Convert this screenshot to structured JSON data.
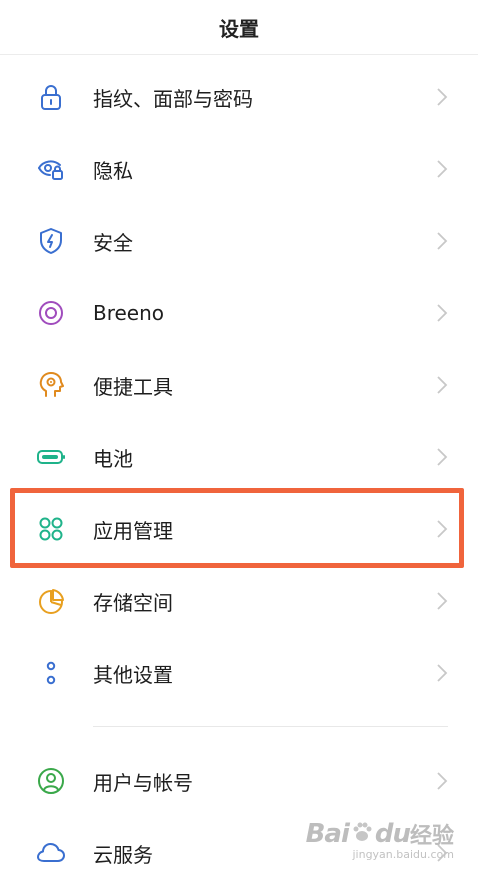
{
  "header": {
    "title": "设置"
  },
  "items": [
    {
      "label": "指纹、面部与密码",
      "icon": "lock-icon",
      "color": "#3a6fd0"
    },
    {
      "label": "隐私",
      "icon": "privacy-eye-icon",
      "color": "#3a6fd0"
    },
    {
      "label": "安全",
      "icon": "shield-icon",
      "color": "#3a6fd0"
    },
    {
      "label": "Breeno",
      "icon": "breeno-ring-icon",
      "color": "#a04cbd"
    },
    {
      "label": "便捷工具",
      "icon": "head-gear-icon",
      "color": "#e08a1e"
    },
    {
      "label": "电池",
      "icon": "battery-icon",
      "color": "#1fb38a"
    },
    {
      "label": "应用管理",
      "icon": "apps-grid-icon",
      "color": "#1fb38a"
    },
    {
      "label": "存储空间",
      "icon": "storage-pie-icon",
      "color": "#e8a020"
    },
    {
      "label": "其他设置",
      "icon": "more-dots-icon",
      "color": "#3a6fd0"
    },
    {
      "label": "用户与帐号",
      "icon": "user-icon",
      "color": "#3aa84a"
    },
    {
      "label": "云服务",
      "icon": "cloud-icon",
      "color": "#3a6fd0"
    }
  ],
  "highlight_color": "#f0643c",
  "watermark": {
    "logo_text_b": "Bai",
    "logo_text_du": "du",
    "logo_text_cn": "经验",
    "url": "jingyan.baidu.com"
  }
}
